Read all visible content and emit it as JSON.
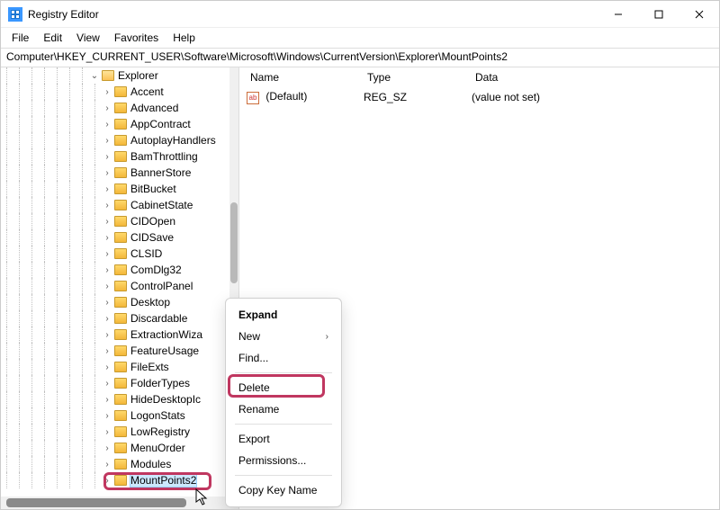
{
  "window": {
    "title": "Registry Editor"
  },
  "menu": {
    "file": "File",
    "edit": "Edit",
    "view": "View",
    "favorites": "Favorites",
    "help": "Help"
  },
  "address": "Computer\\HKEY_CURRENT_USER\\Software\\Microsoft\\Windows\\CurrentVersion\\Explorer\\MountPoints2",
  "tree": {
    "root_label": "Explorer",
    "items": [
      "Accent",
      "Advanced",
      "AppContract",
      "AutoplayHandlers",
      "BamThrottling",
      "BannerStore",
      "BitBucket",
      "CabinetState",
      "CIDOpen",
      "CIDSave",
      "CLSID",
      "ComDlg32",
      "ControlPanel",
      "Desktop",
      "Discardable",
      "ExtractionWiza",
      "FeatureUsage",
      "FileExts",
      "FolderTypes",
      "HideDesktopIc",
      "LogonStats",
      "LowRegistry",
      "MenuOrder",
      "Modules",
      "MountPoints2"
    ],
    "selected_index": 24
  },
  "list": {
    "cols": {
      "name": "Name",
      "type": "Type",
      "data": "Data"
    },
    "rows": [
      {
        "name": "(Default)",
        "type": "REG_SZ",
        "data": "(value not set)"
      }
    ]
  },
  "context_menu": {
    "expand": "Expand",
    "new": "New",
    "find": "Find...",
    "delete": "Delete",
    "rename": "Rename",
    "export": "Export",
    "permissions": "Permissions...",
    "copy_key_name": "Copy Key Name"
  }
}
